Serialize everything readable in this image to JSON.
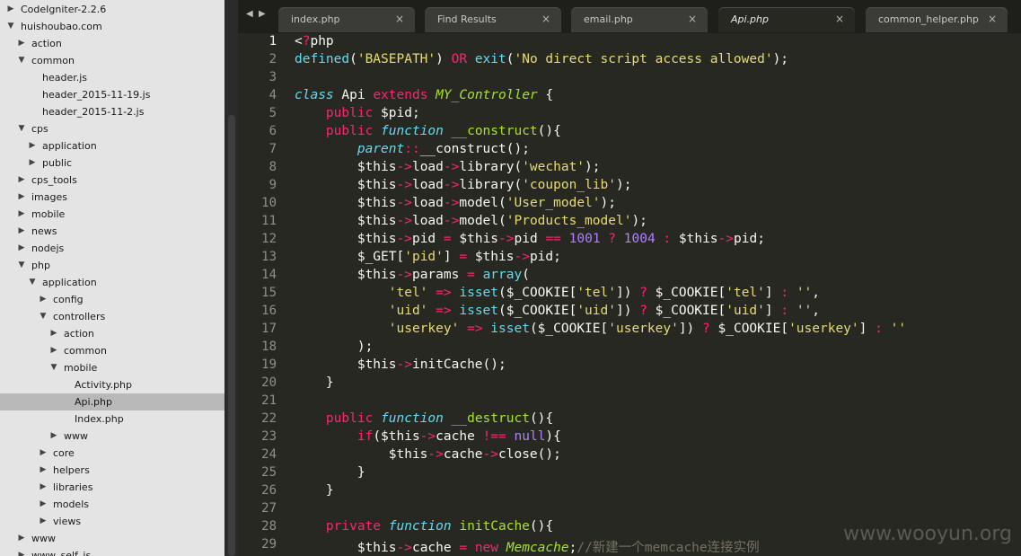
{
  "sidebar": {
    "items": [
      {
        "label": "CodeIgniter-2.2.6",
        "depth": 0,
        "arrow": "right"
      },
      {
        "label": "huishoubao.com",
        "depth": 0,
        "arrow": "down"
      },
      {
        "label": "action",
        "depth": 1,
        "arrow": "right"
      },
      {
        "label": "common",
        "depth": 1,
        "arrow": "down"
      },
      {
        "label": "header.js",
        "depth": 2,
        "arrow": ""
      },
      {
        "label": "header_2015-11-19.js",
        "depth": 2,
        "arrow": ""
      },
      {
        "label": "header_2015-11-2.js",
        "depth": 2,
        "arrow": ""
      },
      {
        "label": "cps",
        "depth": 1,
        "arrow": "down"
      },
      {
        "label": "application",
        "depth": 2,
        "arrow": "right"
      },
      {
        "label": "public",
        "depth": 2,
        "arrow": "right"
      },
      {
        "label": "cps_tools",
        "depth": 1,
        "arrow": "right"
      },
      {
        "label": "images",
        "depth": 1,
        "arrow": "right"
      },
      {
        "label": "mobile",
        "depth": 1,
        "arrow": "right"
      },
      {
        "label": "news",
        "depth": 1,
        "arrow": "right"
      },
      {
        "label": "nodejs",
        "depth": 1,
        "arrow": "right"
      },
      {
        "label": "php",
        "depth": 1,
        "arrow": "down"
      },
      {
        "label": "application",
        "depth": 2,
        "arrow": "down"
      },
      {
        "label": "config",
        "depth": 3,
        "arrow": "right"
      },
      {
        "label": "controllers",
        "depth": 3,
        "arrow": "down"
      },
      {
        "label": "action",
        "depth": 4,
        "arrow": "right"
      },
      {
        "label": "common",
        "depth": 4,
        "arrow": "right"
      },
      {
        "label": "mobile",
        "depth": 4,
        "arrow": "down"
      },
      {
        "label": "Activity.php",
        "depth": 5,
        "arrow": ""
      },
      {
        "label": "Api.php",
        "depth": 5,
        "arrow": "",
        "selected": true
      },
      {
        "label": "Index.php",
        "depth": 5,
        "arrow": ""
      },
      {
        "label": "www",
        "depth": 4,
        "arrow": "right"
      },
      {
        "label": "core",
        "depth": 3,
        "arrow": "right"
      },
      {
        "label": "helpers",
        "depth": 3,
        "arrow": "right"
      },
      {
        "label": "libraries",
        "depth": 3,
        "arrow": "right"
      },
      {
        "label": "models",
        "depth": 3,
        "arrow": "right"
      },
      {
        "label": "views",
        "depth": 3,
        "arrow": "right"
      },
      {
        "label": "www",
        "depth": 1,
        "arrow": "right"
      },
      {
        "label": "www_self_js",
        "depth": 1,
        "arrow": "right"
      }
    ]
  },
  "tabs": [
    {
      "label": "index.php",
      "close": "×",
      "active": false
    },
    {
      "label": "Find Results",
      "close": "×",
      "active": false
    },
    {
      "label": "email.php",
      "close": "×",
      "active": false
    },
    {
      "label": "Api.php",
      "close": "×",
      "active": true
    },
    {
      "label": "common_helper.php",
      "close": "×",
      "active": false
    }
  ],
  "nav": {
    "back": "◀",
    "forward": "▶"
  },
  "editor": {
    "current_line": 1,
    "lines": [
      {
        "n": "1",
        "t": "<?php"
      },
      {
        "n": "2",
        "t": "defined('BASEPATH') OR exit('No direct script access allowed');"
      },
      {
        "n": "3",
        "t": ""
      },
      {
        "n": "4",
        "t": "class Api extends MY_Controller {"
      },
      {
        "n": "5",
        "t": "    public $pid;"
      },
      {
        "n": "6",
        "t": "    public function __construct(){"
      },
      {
        "n": "7",
        "t": "        parent::__construct();"
      },
      {
        "n": "8",
        "t": "        $this->load->library('wechat');"
      },
      {
        "n": "9",
        "t": "        $this->load->library('coupon_lib');"
      },
      {
        "n": "10",
        "t": "        $this->load->model('User_model');"
      },
      {
        "n": "11",
        "t": "        $this->load->model('Products_model');"
      },
      {
        "n": "12",
        "t": "        $this->pid = $this->pid == 1001 ? 1004 : $this->pid;"
      },
      {
        "n": "13",
        "t": "        $_GET['pid'] = $this->pid;"
      },
      {
        "n": "14",
        "t": "        $this->params = array("
      },
      {
        "n": "15",
        "t": "            'tel' => isset($_COOKIE['tel']) ? $_COOKIE['tel'] : '',"
      },
      {
        "n": "16",
        "t": "            'uid' => isset($_COOKIE['uid']) ? $_COOKIE['uid'] : '',"
      },
      {
        "n": "17",
        "t": "            'userkey' => isset($_COOKIE['userkey']) ? $_COOKIE['userkey'] : ''"
      },
      {
        "n": "18",
        "t": "        );"
      },
      {
        "n": "19",
        "t": "        $this->initCache();"
      },
      {
        "n": "20",
        "t": "    }"
      },
      {
        "n": "21",
        "t": ""
      },
      {
        "n": "22",
        "t": "    public function __destruct(){"
      },
      {
        "n": "23",
        "t": "        if($this->cache !== null){"
      },
      {
        "n": "24",
        "t": "            $this->cache->close();"
      },
      {
        "n": "25",
        "t": "        }"
      },
      {
        "n": "26",
        "t": "    }"
      },
      {
        "n": "27",
        "t": ""
      },
      {
        "n": "28",
        "t": "    private function initCache(){"
      },
      {
        "n": "29",
        "t": "        $this->cache = new Memcache;//新建一个memcache连接实例"
      }
    ]
  },
  "watermark": "www.wooyun.org",
  "colors": {
    "bg": "#272822",
    "keyword": "#f92672",
    "string": "#e6db74",
    "number": "#ae81ff",
    "function": "#a6e22e",
    "storage": "#66d9ef",
    "comment": "#75715e"
  }
}
